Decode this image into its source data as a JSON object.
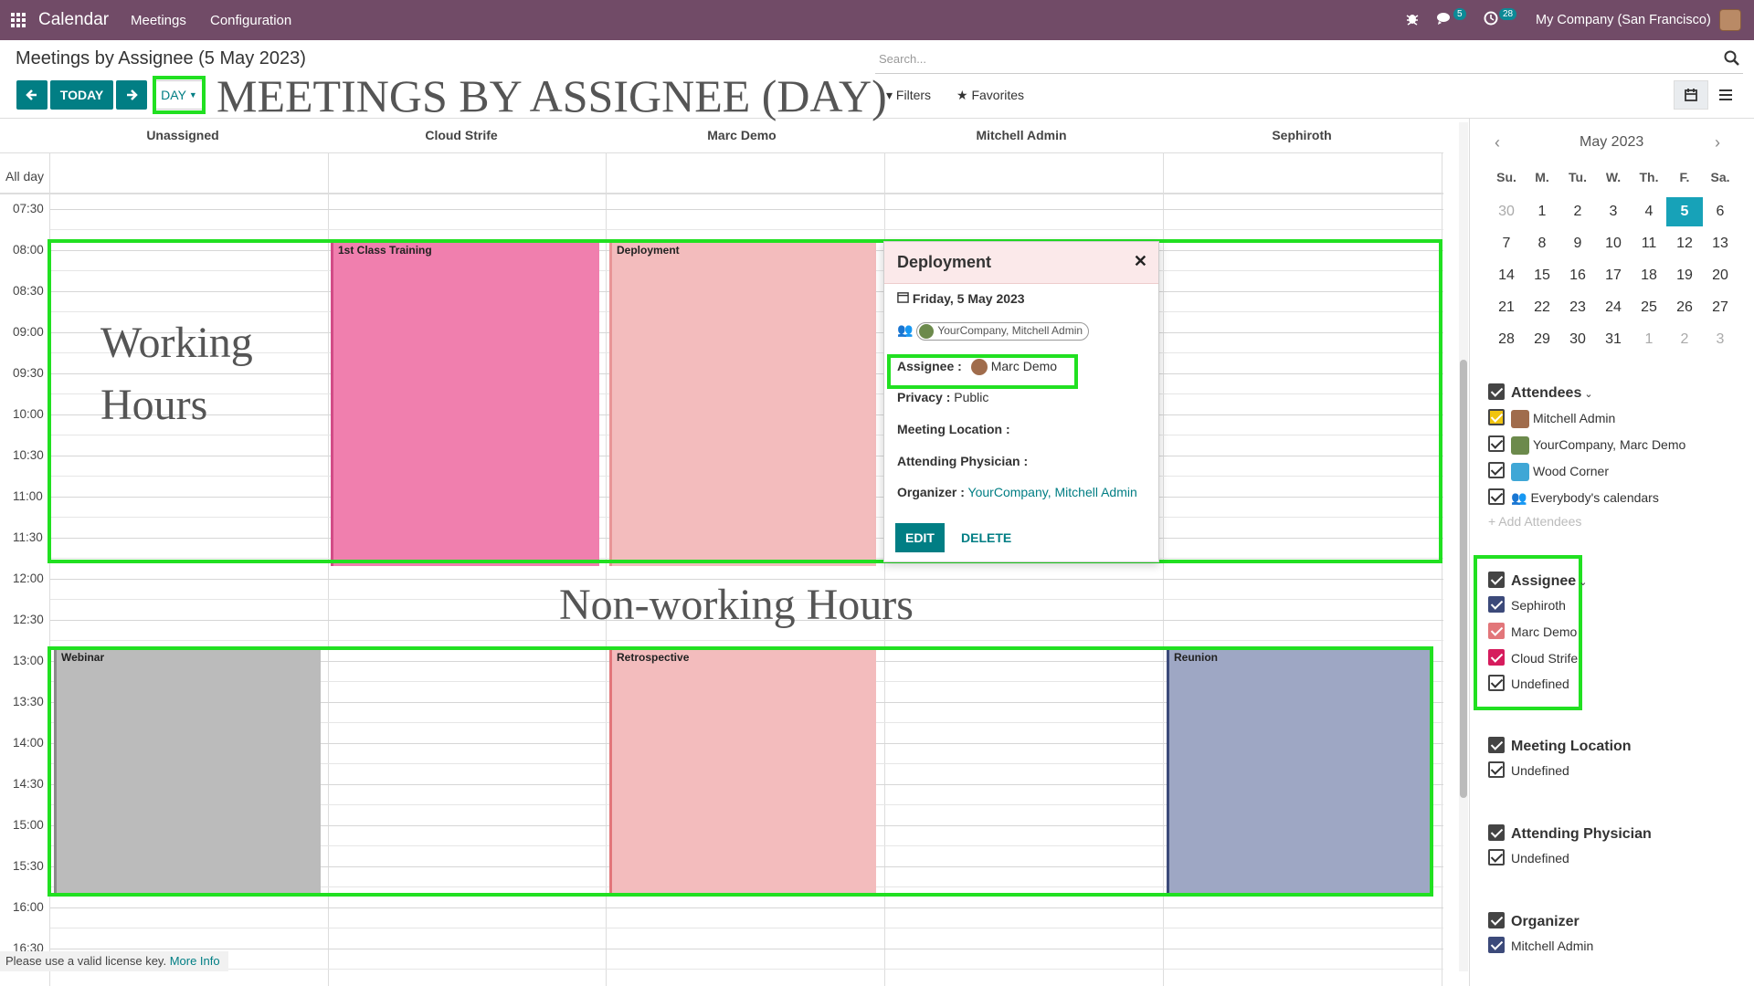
{
  "topbar": {
    "app": "Calendar",
    "menu": [
      "Meetings",
      "Configuration"
    ],
    "chat_count": "5",
    "activity_count": "28",
    "company": "My Company (San Francisco)"
  },
  "control_panel": {
    "breadcrumb": "Meetings by Assignee (5 May 2023)",
    "today": "TODAY",
    "scale": "DAY",
    "overlay_title": "MEETINGS BY ASSIGNEE (DAY)",
    "search_placeholder": "Search...",
    "filters": "Filters",
    "favorites": "Favorites"
  },
  "calendar": {
    "columns": [
      "Unassigned",
      "Cloud Strife",
      "Marc Demo",
      "Mitchell Admin",
      "Sephiroth"
    ],
    "allday_label": "All day",
    "times": [
      "07:30",
      "08:00",
      "08:30",
      "09:00",
      "09:30",
      "10:00",
      "10:30",
      "11:00",
      "11:30",
      "12:00",
      "12:30",
      "13:00",
      "13:30",
      "14:00",
      "14:30",
      "15:00",
      "15:30",
      "16:00",
      "16:30"
    ],
    "events": [
      {
        "title": "1st Class Training",
        "color": "#f07fae",
        "border": "#d24c87"
      },
      {
        "title": "Deployment",
        "color": "#f3bcbd",
        "border": "#e89597"
      },
      {
        "title": "Webinar",
        "color": "#bbbbbb",
        "border": "#8a8a8a"
      },
      {
        "title": "Retrospective",
        "color": "#f3bcbd",
        "border": "#e2767a"
      },
      {
        "title": "Reunion",
        "color": "#9ea7c4",
        "border": "#3c4a7a"
      }
    ],
    "overlay_labels": {
      "working_1": "Working",
      "working_2": "Hours",
      "nonworking": "Non-working Hours"
    }
  },
  "popover": {
    "title": "Deployment",
    "date": "Friday, 5 May 2023",
    "attendees": "YourCompany, Mitchell Admin",
    "assignee_label": "Assignee :",
    "assignee": "Marc Demo",
    "privacy_label": "Privacy :",
    "privacy": "Public",
    "location_label": "Meeting Location :",
    "physician_label": "Attending Physician :",
    "organizer_label": "Organizer :",
    "organizer": "YourCompany, Mitchell Admin",
    "edit": "EDIT",
    "delete": "DELETE"
  },
  "license": {
    "text": "Please use a valid license key.",
    "link": "More Info"
  },
  "sidebar": {
    "month": "May 2023",
    "dow": [
      "Su.",
      "M.",
      "Tu.",
      "W.",
      "Th.",
      "F.",
      "Sa."
    ],
    "weeks": [
      [
        "30",
        "1",
        "2",
        "3",
        "4",
        "5",
        "6"
      ],
      [
        "7",
        "8",
        "9",
        "10",
        "11",
        "12",
        "13"
      ],
      [
        "14",
        "15",
        "16",
        "17",
        "18",
        "19",
        "20"
      ],
      [
        "21",
        "22",
        "23",
        "24",
        "25",
        "26",
        "27"
      ],
      [
        "28",
        "29",
        "30",
        "31",
        "1",
        "2",
        "3"
      ]
    ],
    "attendees": {
      "title": "Attendees",
      "items": [
        "Mitchell Admin",
        "YourCompany, Marc Demo",
        "Wood Corner",
        "Everybody's calendars"
      ],
      "add": "+ Add Attendees"
    },
    "assignee": {
      "title": "Assignee",
      "items": [
        "Sephiroth",
        "Marc Demo",
        "Cloud Strife",
        "Undefined"
      ],
      "colors": [
        "#3c4a7a",
        "#e2767a",
        "#d61c5d",
        "#ffffff"
      ]
    },
    "location": {
      "title": "Meeting Location",
      "items": [
        "Undefined"
      ]
    },
    "physician": {
      "title": "Attending Physician",
      "items": [
        "Undefined"
      ]
    },
    "organizer": {
      "title": "Organizer",
      "items": [
        "Mitchell Admin"
      ]
    }
  }
}
